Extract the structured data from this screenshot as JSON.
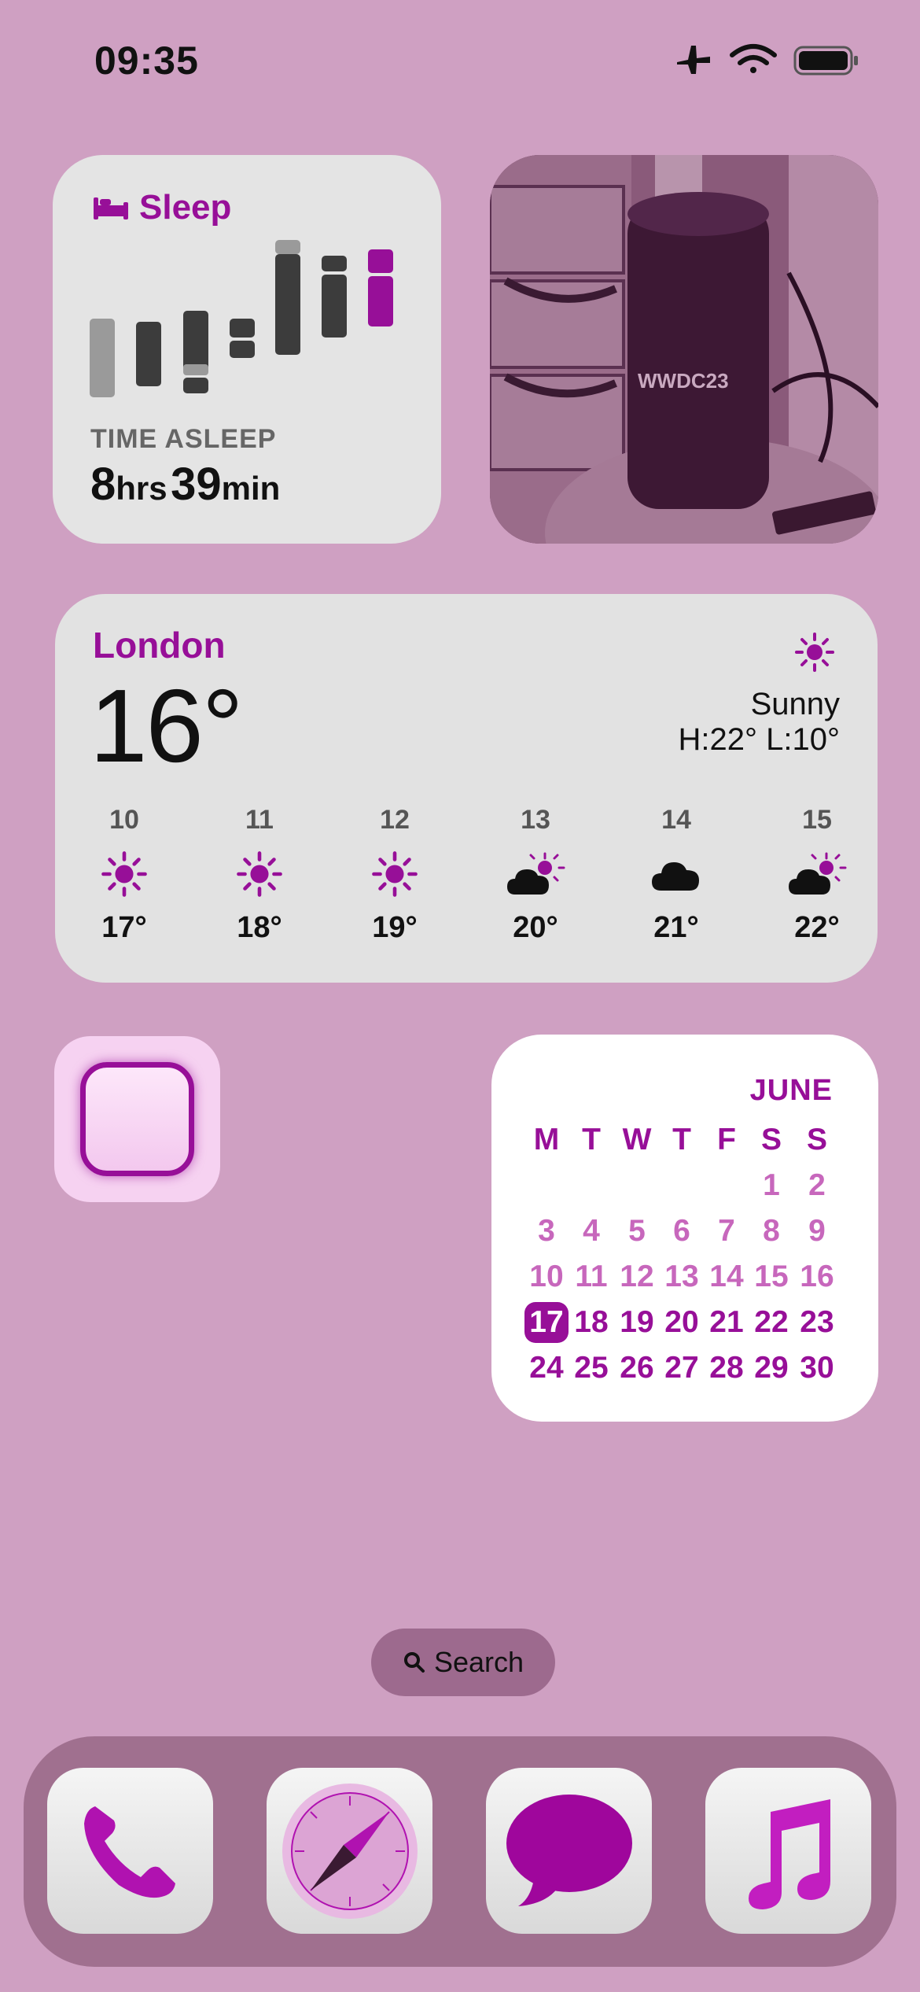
{
  "status_bar": {
    "time": "09:35",
    "icons": [
      "airplane-icon",
      "wifi-icon",
      "battery-icon"
    ]
  },
  "sleep_widget": {
    "title": "Sleep",
    "icon": "bed-icon",
    "caption": "TIME ASLEEP",
    "hours_value": "8",
    "hours_unit": "hrs",
    "minutes_value": "39",
    "minutes_unit": "min"
  },
  "photo_widget": {
    "icon": "photo-icon",
    "bottle_text": "WWDC23"
  },
  "weather_widget": {
    "city": "London",
    "temperature": "16°",
    "condition": "Sunny",
    "high_low": "H:22° L:10°",
    "condition_icon": "sun-icon",
    "forecast": [
      {
        "hour": "10",
        "icon": "sun-icon",
        "temp": "17°"
      },
      {
        "hour": "11",
        "icon": "sun-icon",
        "temp": "18°"
      },
      {
        "hour": "12",
        "icon": "sun-icon",
        "temp": "19°"
      },
      {
        "hour": "13",
        "icon": "cloud-sun-icon",
        "temp": "20°"
      },
      {
        "hour": "14",
        "icon": "cloud-icon",
        "temp": "21°"
      },
      {
        "hour": "15",
        "icon": "cloud-sun-icon",
        "temp": "22°"
      }
    ]
  },
  "focus_widget": {
    "icon": "rounded-square-icon"
  },
  "calendar_widget": {
    "month": "JUNE",
    "weekdays": [
      "M",
      "T",
      "W",
      "T",
      "F",
      "S",
      "S"
    ],
    "weeks": [
      [
        "",
        "",
        "",
        "",
        "",
        "1",
        "2"
      ],
      [
        "3",
        "4",
        "5",
        "6",
        "7",
        "8",
        "9"
      ],
      [
        "10",
        "11",
        "12",
        "13",
        "14",
        "15",
        "16"
      ],
      [
        "17",
        "18",
        "19",
        "20",
        "21",
        "22",
        "23"
      ],
      [
        "24",
        "25",
        "26",
        "27",
        "28",
        "29",
        "30"
      ]
    ],
    "today": "17"
  },
  "search": {
    "label": "Search",
    "icon": "search-icon"
  },
  "dock": {
    "apps": [
      "phone-icon",
      "safari-compass-icon",
      "messages-icon",
      "music-icon"
    ]
  },
  "colors": {
    "wallpaper": "#cfa0c2",
    "accent": "#970f98",
    "dock": "#a0708f"
  }
}
